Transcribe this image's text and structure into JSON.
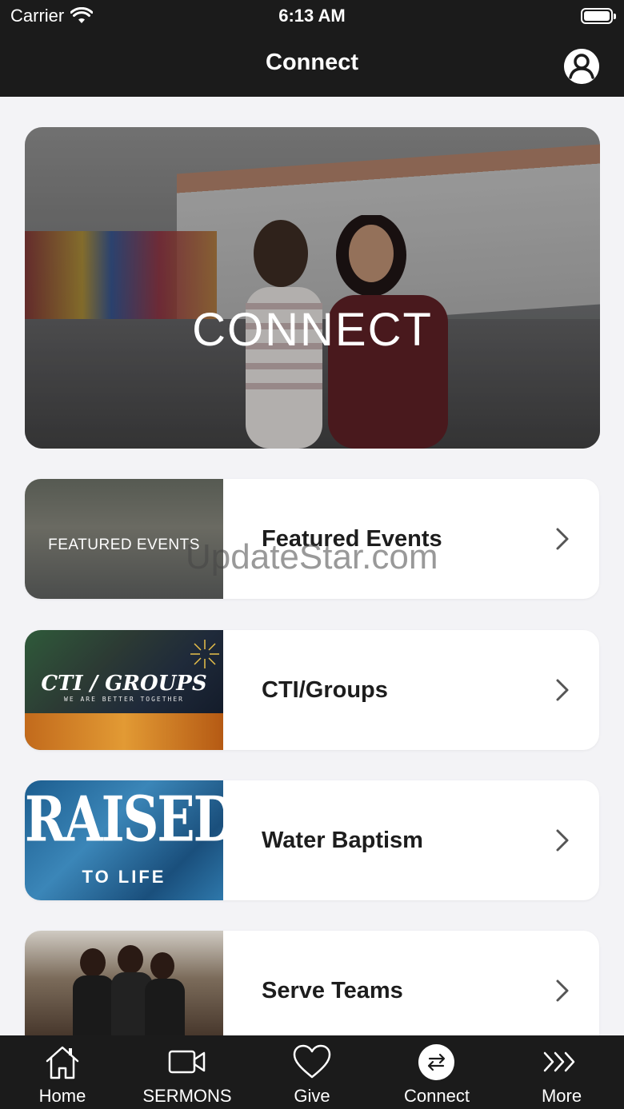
{
  "status_bar": {
    "carrier": "Carrier",
    "time": "6:13 AM"
  },
  "nav": {
    "title": "Connect",
    "profile_icon": "person-circle-icon"
  },
  "hero": {
    "text": "CONNECT"
  },
  "items": [
    {
      "label": "Featured Events",
      "thumb_text": "FEATURED EVENTS"
    },
    {
      "label": "CTI/Groups",
      "thumb_text": "CTI / GROUPS",
      "thumb_sub": "WE ARE BETTER TOGETHER"
    },
    {
      "label": "Water Baptism",
      "thumb_text": "RAISED",
      "thumb_sub": "TO LIFE"
    },
    {
      "label": "Serve Teams"
    }
  ],
  "watermark": "UpdateStar.com",
  "tabs": [
    {
      "label": "Home",
      "icon": "home-icon"
    },
    {
      "label": "SERMONS",
      "icon": "video-icon"
    },
    {
      "label": "Give",
      "icon": "heart-icon"
    },
    {
      "label": "Connect",
      "icon": "arrows-exchange-icon",
      "active": true
    },
    {
      "label": "More",
      "icon": "chevrons-right-icon"
    }
  ]
}
